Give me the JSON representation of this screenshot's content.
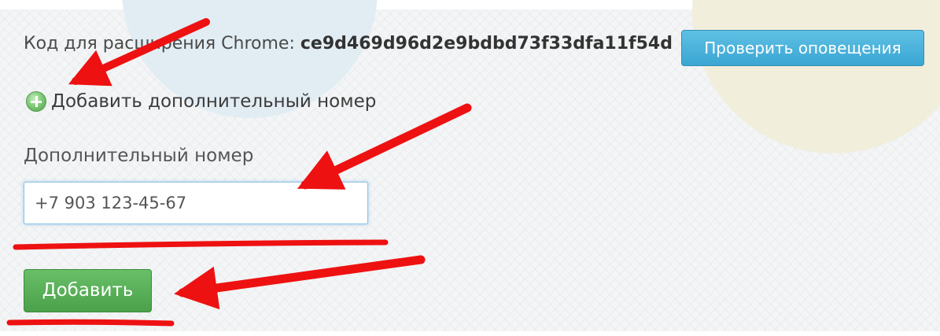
{
  "extension": {
    "label": "Код для расширения Chrome:",
    "code": "ce9d469d96d2e9bdbd73f33dfa11f54d"
  },
  "check_button": {
    "label": "Проверить оповещения"
  },
  "add_number_link": {
    "icon": "plus-circle-icon",
    "label": "Добавить дополнительный номер"
  },
  "extra_number": {
    "label": "Дополнительный номер",
    "value": "+7 903 123-45-67"
  },
  "add_button": {
    "label": "Добавить"
  },
  "colors": {
    "annotation": "#ee1111",
    "check_button": "#45acd8",
    "add_button": "#55aa55"
  }
}
